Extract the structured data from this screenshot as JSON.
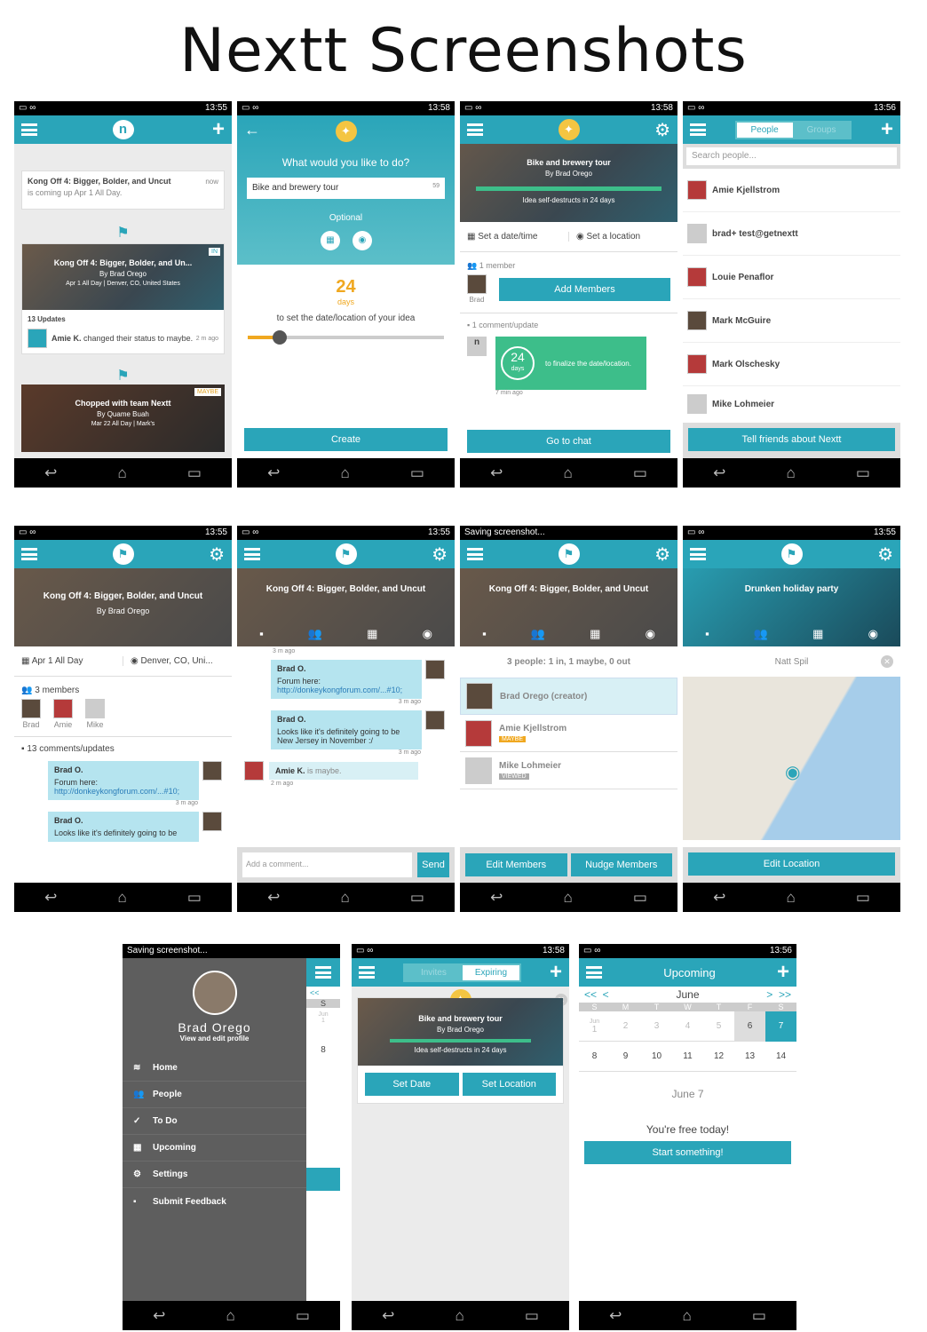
{
  "page_title": "Nextt Screenshots",
  "status": {
    "t1": "13:55",
    "t2": "13:58",
    "t3": "13:58",
    "t4": "13:56",
    "t5": "13:55",
    "t6": "13:55",
    "t7": "Saving screenshot...",
    "t8": "13:55",
    "t9": "Saving screenshot...",
    "t10": "13:58",
    "t11": "13:56"
  },
  "s1": {
    "notif_title": "Kong Off 4: Bigger, Bolder, and Uncut",
    "notif_sub": "is coming up Apr 1 All Day.",
    "notif_time": "now",
    "ev1_title": "Kong Off 4: Bigger, Bolder, and Un...",
    "ev1_by": "By Brad Orego",
    "ev1_meta": "Apr 1 All Day | Denver, CO, United States",
    "ev1_badge": "IN",
    "updates": "13 Updates",
    "upd_name": "Amie K.",
    "upd_text": "changed their status to maybe.",
    "upd_time": "2 m ago",
    "ev2_title": "Chopped with team Nextt",
    "ev2_by": "By Quame Buah",
    "ev2_meta": "Mar 22 All Day | Mark's",
    "ev2_badge": "MAYBE"
  },
  "s2": {
    "question": "What would you like to do?",
    "input": "Bike and brewery tour",
    "count": "59",
    "optional": "Optional",
    "days": "24",
    "days_label": "days",
    "desc": "to set the date/location of your idea",
    "create": "Create"
  },
  "s3": {
    "title": "Bike and brewery tour",
    "by": "By Brad Orego",
    "destruct": "Idea self-destructs in 24 days",
    "set_date": "Set a date/time",
    "set_loc": "Set a location",
    "members": "1 member",
    "member_name": "Brad",
    "add": "Add Members",
    "comments": "1 comment/update",
    "days": "24",
    "days_label": "days",
    "finalize": "to finalize the date/location.",
    "ago": "7 min ago",
    "chat": "Go to chat"
  },
  "s4": {
    "tab1": "People",
    "tab2": "Groups",
    "search": "Search people...",
    "people": [
      "Amie Kjellstrom",
      "brad+ test@getnextt",
      "Louie Penaflor",
      "Mark McGuire",
      "Mark Olschesky",
      "Mike Lohmeier"
    ],
    "tell": "Tell friends about Nextt"
  },
  "s5": {
    "title": "Kong Off 4: Bigger, Bolder, and Uncut",
    "by": "By Brad Orego",
    "date": "Apr 1 All Day",
    "loc": "Denver, CO, Uni...",
    "members": "3 members",
    "m1": "Brad",
    "m2": "Amie",
    "m3": "Mike",
    "comments": "13 comments/updates",
    "c1_name": "Brad O.",
    "c1_text": "Forum here:",
    "c1_link": "http://donkeykongforum.com/...#10;",
    "c1_time": "3 m ago",
    "c2_name": "Brad O.",
    "c2_text": "Looks like it's definitely going to be"
  },
  "s6": {
    "title": "Kong Off 4: Bigger, Bolder, and Uncut",
    "ago0": "3 m ago",
    "c1_name": "Brad O.",
    "c1_text": "Forum here:",
    "c1_link": "http://donkeykongforum.com/...#10;",
    "c1_time": "3 m ago",
    "c2_name": "Brad O.",
    "c2_text": "Looks like it's definitely going to be New Jersey in November :/",
    "c2_time": "3 m ago",
    "c3_name": "Amie K.",
    "c3_text": "is maybe.",
    "c3_time": "2 m ago",
    "placeholder": "Add a comment...",
    "send": "Send"
  },
  "s7": {
    "title": "Kong Off 4: Bigger, Bolder, and Uncut",
    "summary": "3 people: 1 in, 1 maybe, 0 out",
    "p1": "Brad Orego (creator)",
    "p2": "Amie Kjellstrom",
    "p2_badge": "MAYBE",
    "p3": "Mike Lohmeier",
    "p3_badge": "VIEWED",
    "edit": "Edit Members",
    "nudge": "Nudge Members"
  },
  "s8": {
    "title": "Drunken holiday party",
    "place": "Natt Spil",
    "edit": "Edit Location"
  },
  "s9": {
    "name": "Brad Orego",
    "sub": "View and edit profile",
    "menu": [
      "Home",
      "People",
      "To Do",
      "Upcoming",
      "Settings",
      "Submit Feedback"
    ],
    "cal_s": "S",
    "cal_jun": "Jun",
    "cal_1": "1",
    "cal_8": "8"
  },
  "s10": {
    "tab1": "Invites",
    "tab2": "Expiring",
    "title": "Bike and brewery tour",
    "by": "By Brad Orego",
    "destruct": "Idea self-destructs in 24 days",
    "set_date": "Set Date",
    "set_loc": "Set Location"
  },
  "s11": {
    "title": "Upcoming",
    "month": "June",
    "days": [
      "S",
      "M",
      "T",
      "W",
      "T",
      "F",
      "S"
    ],
    "w1": [
      "1",
      "2",
      "3",
      "4",
      "5",
      "6",
      "7"
    ],
    "w2": [
      "8",
      "9",
      "10",
      "11",
      "12",
      "13",
      "14"
    ],
    "jun": "Jun",
    "date": "June 7",
    "free": "You're free today!",
    "start": "Start something!"
  }
}
